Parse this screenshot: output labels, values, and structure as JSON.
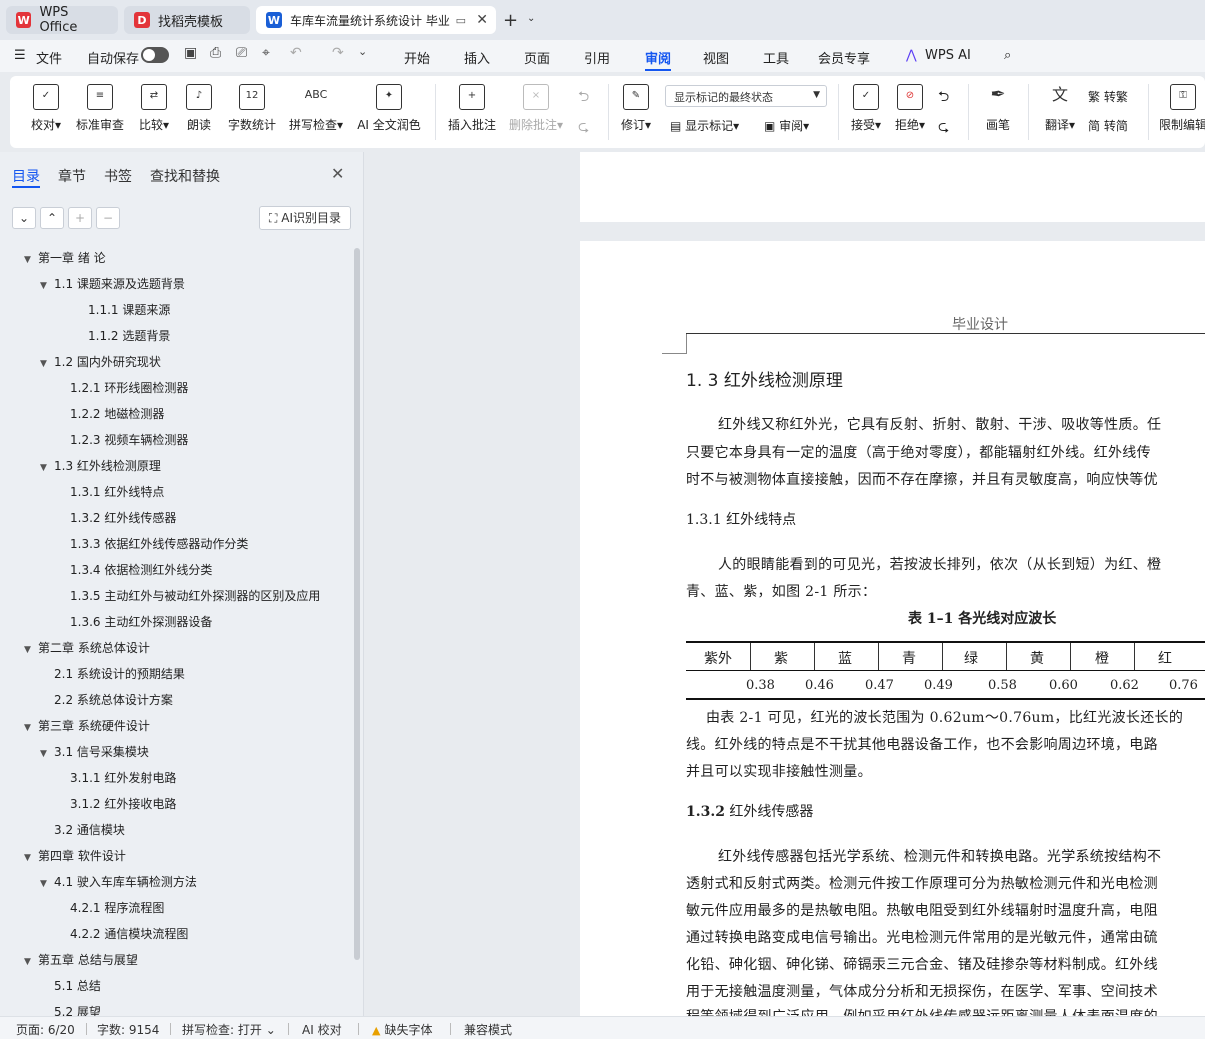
{
  "tabs": [
    {
      "label": "WPS Office",
      "icon": "wps-logo-icon"
    },
    {
      "label": "找稻壳模板",
      "icon": "docer-logo-icon"
    },
    {
      "label": "车库车流量统计系统设计 毕业",
      "icon": "word-doc-icon"
    }
  ],
  "menubar": {
    "file": "文件",
    "autosave": "自动保存",
    "items": [
      "开始",
      "插入",
      "页面",
      "引用",
      "审阅",
      "视图",
      "工具",
      "会员专享",
      "WPS AI"
    ],
    "active": "审阅"
  },
  "ribbon": {
    "proofread": "校对",
    "standard_review": "标准审查",
    "compare": "比较",
    "read_aloud": "朗读",
    "word_count": "字数统计",
    "spell_check": "拼写检查",
    "ai_polish": "AI 全文润色",
    "insert_comment": "插入批注",
    "delete_comment": "删除批注",
    "revise": "修订",
    "markup_select": "显示标记的最终状态",
    "show_markup": "显示标记",
    "review_pane": "审阅",
    "accept": "接受",
    "reject": "拒绝",
    "pen": "画笔",
    "translate": "翻译",
    "to_traditional": "转繁",
    "to_simplified": "转简",
    "restrict_edit": "限制编辑"
  },
  "panel": {
    "tabs": [
      "目录",
      "章节",
      "书签",
      "查找和替换"
    ],
    "ai_toc": "AI识别目录",
    "toc": [
      {
        "label": "第一章  绪    论",
        "level": 0,
        "twisty": true
      },
      {
        "label": "1.1  课题来源及选题背景",
        "level": 1,
        "twisty": true
      },
      {
        "label": "1.1.1 课题来源",
        "level": 3,
        "twisty": false
      },
      {
        "label": "1.1.2  选题背景",
        "level": 3,
        "twisty": false
      },
      {
        "label": "1.2  国内外研究现状",
        "level": 1,
        "twisty": true
      },
      {
        "label": "1.2.1 环形线圈检测器",
        "level": 2,
        "twisty": false
      },
      {
        "label": "1.2.2 地磁检测器",
        "level": 2,
        "twisty": false
      },
      {
        "label": "1.2.3 视频车辆检测器",
        "level": 2,
        "twisty": false
      },
      {
        "label": "1.3 红外线检测原理",
        "level": 1,
        "twisty": true
      },
      {
        "label": "1.3.1 红外线特点",
        "level": 2,
        "twisty": false
      },
      {
        "label": "1.3.2 红外线传感器",
        "level": 2,
        "twisty": false
      },
      {
        "label": "1.3.3 依据红外线传感器动作分类",
        "level": 2,
        "twisty": false
      },
      {
        "label": "1.3.4 依据检测红外线分类",
        "level": 2,
        "twisty": false
      },
      {
        "label": "1.3.5 主动红外与被动红外探测器的区别及应用",
        "level": 2,
        "twisty": false
      },
      {
        "label": "1.3.6 主动红外探测器设备",
        "level": 2,
        "twisty": false
      },
      {
        "label": "第二章  系统总体设计",
        "level": 0,
        "twisty": true
      },
      {
        "label": "2.1 系统设计的预期结果",
        "level": 1,
        "twisty": false
      },
      {
        "label": "2.2 系统总体设计方案",
        "level": 1,
        "twisty": false
      },
      {
        "label": "第三章  系统硬件设计",
        "level": 0,
        "twisty": true
      },
      {
        "label": "3.1 信号采集模块",
        "level": 1,
        "twisty": true
      },
      {
        "label": "3.1.1 红外发射电路",
        "level": 2,
        "twisty": false
      },
      {
        "label": "3.1.2  红外接收电路",
        "level": 2,
        "twisty": false
      },
      {
        "label": "3.2 通信模块",
        "level": 1,
        "twisty": false
      },
      {
        "label": "第四章  软件设计",
        "level": 0,
        "twisty": true
      },
      {
        "label": "4.1 驶入车库车辆检测方法",
        "level": 1,
        "twisty": true
      },
      {
        "label": "4.2.1 程序流程图",
        "level": 2,
        "twisty": false
      },
      {
        "label": "4.2.2  通信模块流程图",
        "level": 2,
        "twisty": false
      },
      {
        "label": "第五章  总结与展望",
        "level": 0,
        "twisty": true
      },
      {
        "label": "5.1  总结",
        "level": 1,
        "twisty": false
      },
      {
        "label": "5.2  展望",
        "level": 1,
        "twisty": false
      }
    ]
  },
  "doc": {
    "header": "毕业设计",
    "section_title": "1. 3 红外线检测原理",
    "para1": [
      "红外线又称红外光，它具有反射、折射、散射、干涉、吸收等性质。任",
      "只要它本身具有一定的温度（高于绝对零度），都能辐射红外线。红外线传",
      "时不与被测物体直接接触，因而不存在摩擦，并且有灵敏度高，响应快等优"
    ],
    "sub1": "1.3.1 红外线特点",
    "para2": [
      "人的眼睛能看到的可见光，若按波长排列，依次（从长到短）为红、橙",
      "青、蓝、紫，如图 2-1 所示："
    ],
    "table_caption": "表 1–1 各光线对应波长",
    "table_headers": [
      "紫外",
      "紫",
      "蓝",
      "青",
      "绿",
      "黄",
      "橙",
      "红"
    ],
    "table_values": [
      "0.38",
      "0.46",
      "0.47",
      "0.49",
      "0.58",
      "0.60",
      "0.62",
      "0.76"
    ],
    "para3": [
      "由表 2-1 可见，红光的波长范围为 0.62um～0.76um，比红光波长还长的",
      "线。红外线的特点是不干扰其他电器设备工作，也不会影响周边环境，电路",
      "并且可以实现非接触性测量。"
    ],
    "sub2_num": "1.3.2",
    "sub2_text": " 红外线传感器",
    "para4": [
      "红外线传感器包括光学系统、检测元件和转换电路。光学系统按结构不",
      "透射式和反射式两类。检测元件按工作原理可分为热敏检测元件和光电检测",
      "敏元件应用最多的是热敏电阻。热敏电阻受到红外线辐射时温度升高，电阻",
      "通过转换电路变成电信号输出。光电检测元件常用的是光敏元件，通常由硫",
      "化铅、砷化铟、砷化锑、碲镉汞三元合金、锗及硅掺杂等材料制成。红外线",
      "用于无接触温度测量，气体成分分析和无损探伤，在医学、军事、空间技术",
      "程等领域得到广泛应用。例如采用红外线传感器远距离测量人体表面温度的"
    ]
  },
  "status": {
    "page": "页面: 6/20",
    "words": "字数: 9154",
    "spell": "拼写检查: 打开",
    "ai_check": "AI 校对",
    "missing_font": "缺失字体",
    "compat": "兼容模式"
  },
  "colors": {
    "accent": "#1456f0",
    "wps_red": "#e3343a",
    "word_blue": "#1a5fd6"
  }
}
